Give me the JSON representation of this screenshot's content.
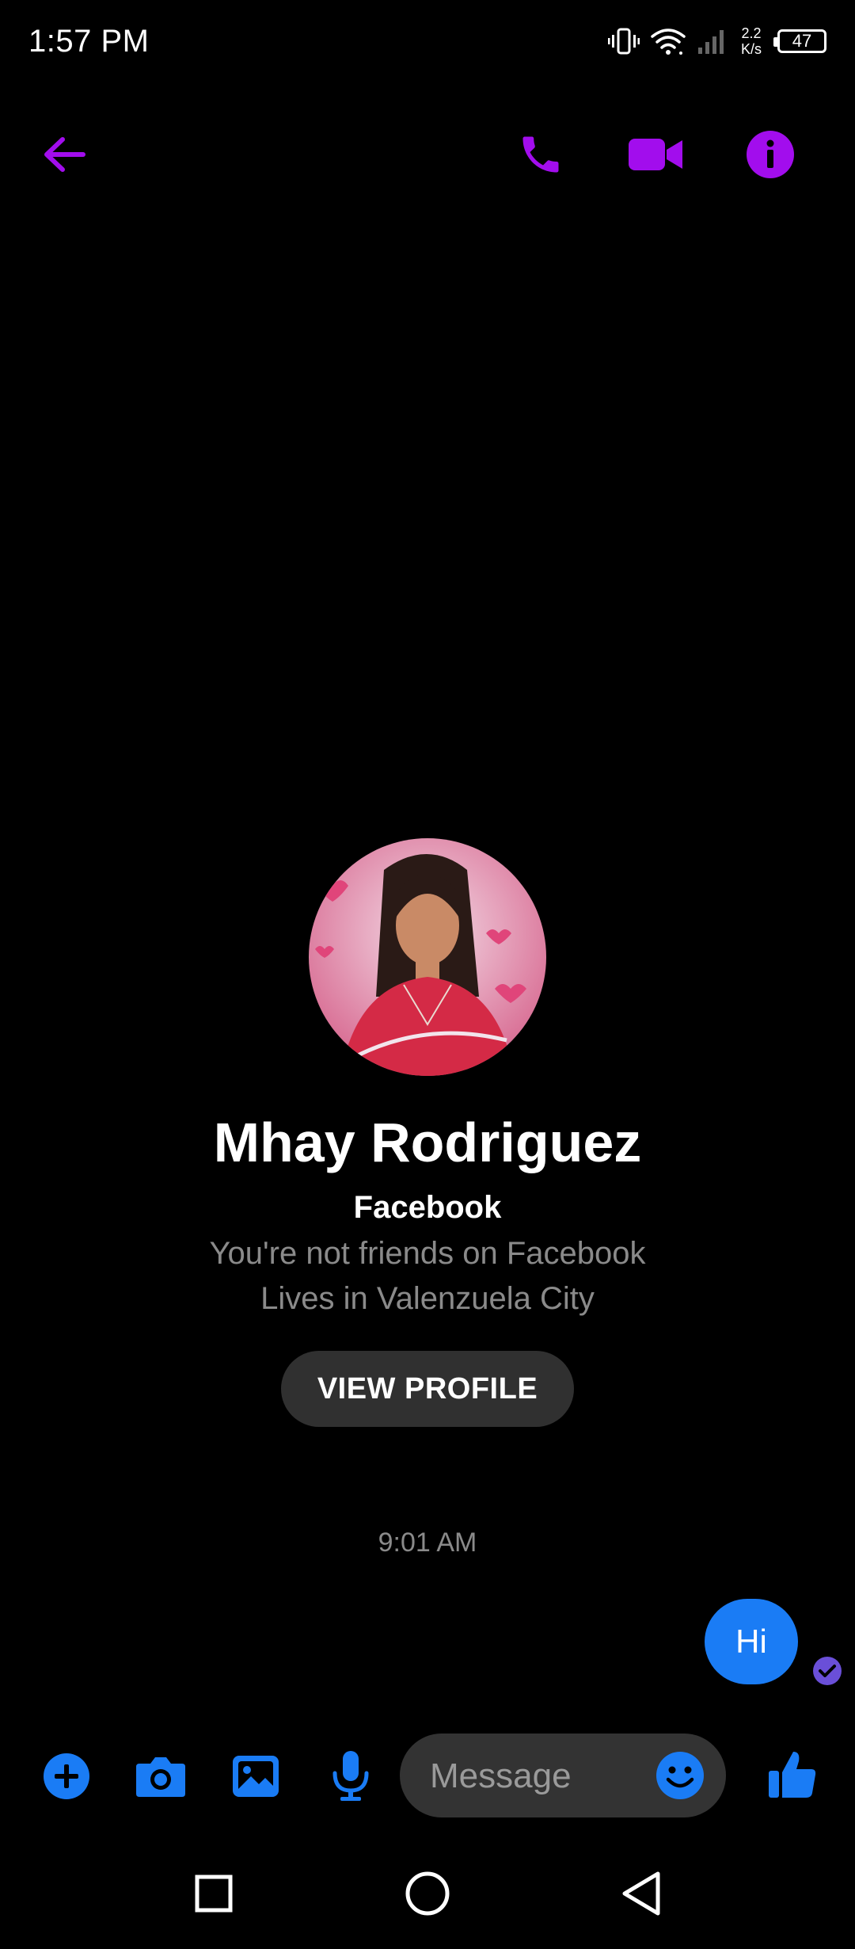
{
  "status_bar": {
    "time": "1:57 PM",
    "net_speed_value": "2.2",
    "net_speed_unit": "K/s",
    "battery": "47",
    "icons": [
      "vibrate-icon",
      "wifi-icon",
      "signal-icon",
      "battery-icon"
    ]
  },
  "header": {
    "icons": [
      "back-arrow-icon",
      "phone-icon",
      "video-camera-icon",
      "info-icon"
    ],
    "accent_color": "#a20ded"
  },
  "profile": {
    "name": "Mhay Rodriguez",
    "platform": "Facebook",
    "friend_status": "You're not friends on Facebook",
    "location": "Lives in Valenzuela City",
    "view_profile_label": "VIEW PROFILE"
  },
  "conversation": {
    "timestamp": "9:01 AM",
    "messages": [
      {
        "text": "Hi",
        "sender": "me",
        "status": "delivered"
      }
    ]
  },
  "composer": {
    "placeholder": "Message",
    "icons": [
      "plus-icon",
      "camera-icon",
      "gallery-icon",
      "microphone-icon",
      "emoji-icon",
      "thumbs-up-icon"
    ],
    "accent_color": "#1a7cf5"
  },
  "nav_bar": {
    "icons": [
      "recents-icon",
      "home-icon",
      "back-icon"
    ]
  }
}
